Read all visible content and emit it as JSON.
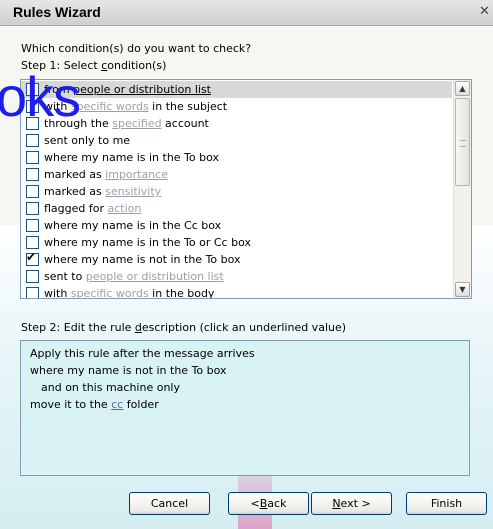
{
  "window": {
    "title": "Rules Wizard",
    "close_glyph": "✕"
  },
  "question": "Which condition(s) do you want to check?",
  "step1": {
    "prefix": "Step 1: Select ",
    "underlined": "c",
    "suffix": "ondition(s)"
  },
  "conditions": [
    {
      "pre": "from ",
      "link": "people or distribution list",
      "post": "",
      "checked": false,
      "selected": true
    },
    {
      "pre": "with ",
      "link": "specific words",
      "post": " in the subject",
      "checked": false,
      "selected": false
    },
    {
      "pre": "through the ",
      "link": "specified",
      "post": " account",
      "checked": false,
      "selected": false
    },
    {
      "pre": "sent only to me",
      "link": "",
      "post": "",
      "checked": false,
      "selected": false
    },
    {
      "pre": "where my name is in the To box",
      "link": "",
      "post": "",
      "checked": false,
      "selected": false
    },
    {
      "pre": "marked as ",
      "link": "importance",
      "post": "",
      "checked": false,
      "selected": false
    },
    {
      "pre": "marked as ",
      "link": "sensitivity",
      "post": "",
      "checked": false,
      "selected": false
    },
    {
      "pre": "flagged for ",
      "link": "action",
      "post": "",
      "checked": false,
      "selected": false
    },
    {
      "pre": "where my name is in the Cc box",
      "link": "",
      "post": "",
      "checked": false,
      "selected": false
    },
    {
      "pre": "where my name is in the To or Cc box",
      "link": "",
      "post": "",
      "checked": false,
      "selected": false
    },
    {
      "pre": "where my name is not in the To box",
      "link": "",
      "post": "",
      "checked": true,
      "selected": false
    },
    {
      "pre": "sent to ",
      "link": "people or distribution list",
      "post": "",
      "checked": false,
      "selected": false
    },
    {
      "pre": "with ",
      "link": "specific words",
      "post": " in the body",
      "checked": false,
      "selected": false
    }
  ],
  "step2": {
    "prefix": "Step 2: Edit the rule ",
    "underlined": "d",
    "suffix": "escription (click an underlined value)"
  },
  "description": {
    "line1": "Apply this rule after the message arrives",
    "line2": "where my name is not in the To box",
    "line3": "and on this machine only",
    "line4_pre": "move it to the ",
    "line4_link": "cc",
    "line4_post": " folder"
  },
  "buttons": {
    "cancel": "Cancel",
    "back_pre": "< ",
    "back_u": "B",
    "back_post": "ack",
    "next_u": "N",
    "next_post": "ext >",
    "finish": "Finish"
  },
  "watermark": "oks",
  "colors": {
    "link_grey": "#9aa0a8",
    "description_bg": "#d9f2f4",
    "watermark_blue": "#1d1df0"
  },
  "icons": {
    "scroll_up": "▲",
    "scroll_down": "▼",
    "check": "✔"
  }
}
